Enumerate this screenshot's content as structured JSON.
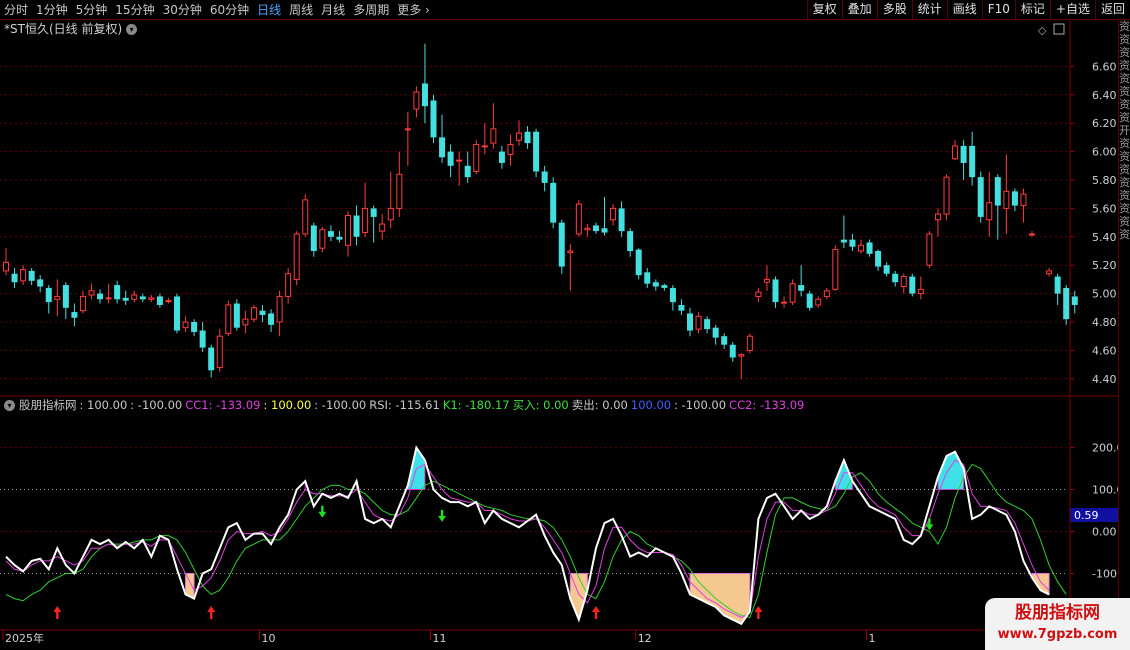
{
  "toolbar": {
    "periods": [
      "分时",
      "1分钟",
      "5分钟",
      "15分钟",
      "30分钟",
      "60分钟",
      "日线",
      "周线",
      "月线",
      "多周期",
      "更多"
    ],
    "active_index": 6,
    "buttons": [
      "复权",
      "叠加",
      "多股",
      "统计",
      "画线",
      "F10",
      "标记",
      "+自选",
      "返回"
    ]
  },
  "title": "*ST恒久(日线 前复权)",
  "indicator_bar": [
    {
      "text": "股朋指标网",
      "color": "#c8c8c8"
    },
    {
      "text": ": 100.00",
      "color": "#c8c8c8"
    },
    {
      "text": ": -100.00",
      "color": "#c8c8c8"
    },
    {
      "text": "CC1: -133.09",
      "color": "#e040e0"
    },
    {
      "text": ": 100.00",
      "color": "#ffff40"
    },
    {
      "text": ": -100.00",
      "color": "#c8c8c8"
    },
    {
      "text": "RSI: -115.61",
      "color": "#c8c8c8"
    },
    {
      "text": "K1: -180.17",
      "color": "#40e040"
    },
    {
      "text": "买入: 0.00",
      "color": "#40e040"
    },
    {
      "text": "卖出: 0.00",
      "color": "#c8c8c8"
    },
    {
      "text": "100.00",
      "color": "#4060ff"
    },
    {
      "text": ": -100.00",
      "color": "#c8c8c8"
    },
    {
      "text": "CC2: -133.09",
      "color": "#e040e0"
    }
  ],
  "right_strip": [
    "资",
    "资",
    "资",
    "资",
    "资",
    "资",
    "资",
    "资",
    "开",
    "资",
    "资",
    "资",
    "资",
    "资",
    "资",
    "资",
    "资"
  ],
  "watermark": {
    "title": "股朋指标网",
    "url": "www.7gpzb.com"
  },
  "chart_data": [
    {
      "type": "candlestick",
      "ylim": [
        4.3,
        6.8
      ],
      "y_ticks": [
        4.4,
        4.6,
        4.8,
        5.0,
        5.2,
        5.4,
        5.6,
        5.8,
        6.0,
        6.2,
        6.4,
        6.6
      ],
      "up_color": "#ff3c3c",
      "down_color": "#44e0e0",
      "candles": [
        [
          5.16,
          5.22,
          5.13,
          5.32
        ],
        [
          5.14,
          5.08,
          5.04,
          5.18
        ],
        [
          5.09,
          5.17,
          5.06,
          5.2
        ],
        [
          5.16,
          5.09,
          5.06,
          5.18
        ],
        [
          5.1,
          5.05,
          5.01,
          5.13
        ],
        [
          5.04,
          4.94,
          4.86,
          5.06
        ],
        [
          4.96,
          4.98,
          4.84,
          5.1
        ],
        [
          5.06,
          4.9,
          4.82,
          5.08
        ],
        [
          4.87,
          4.83,
          4.77,
          4.93
        ],
        [
          4.88,
          4.98,
          4.86,
          5.02
        ],
        [
          4.99,
          5.02,
          4.96,
          5.07
        ],
        [
          5.0,
          4.96,
          4.93,
          5.03
        ],
        [
          4.97,
          4.97,
          4.93,
          5.07
        ],
        [
          5.06,
          4.96,
          4.93,
          5.09
        ],
        [
          4.97,
          4.95,
          4.92,
          5.02
        ],
        [
          4.96,
          4.99,
          4.94,
          5.02
        ],
        [
          4.98,
          4.96,
          4.94,
          5.0
        ],
        [
          4.96,
          4.97,
          4.94,
          4.99
        ],
        [
          4.98,
          4.92,
          4.9,
          5.0
        ],
        [
          4.95,
          4.95,
          4.93,
          4.97
        ],
        [
          4.98,
          4.74,
          4.72,
          5.0
        ],
        [
          4.76,
          4.8,
          4.73,
          4.84
        ],
        [
          4.8,
          4.73,
          4.7,
          4.82
        ],
        [
          4.74,
          4.62,
          4.59,
          4.8
        ],
        [
          4.62,
          4.46,
          4.41,
          4.64
        ],
        [
          4.48,
          4.7,
          4.45,
          4.75
        ],
        [
          4.72,
          4.92,
          4.7,
          4.95
        ],
        [
          4.93,
          4.76,
          4.74,
          4.96
        ],
        [
          4.78,
          4.82,
          4.72,
          4.88
        ],
        [
          4.82,
          4.9,
          4.8,
          4.92
        ],
        [
          4.88,
          4.85,
          4.8,
          4.92
        ],
        [
          4.86,
          4.78,
          4.73,
          4.89
        ],
        [
          4.8,
          4.98,
          4.7,
          5.02
        ],
        [
          4.98,
          5.14,
          4.93,
          5.18
        ],
        [
          5.1,
          5.42,
          5.06,
          5.44
        ],
        [
          5.42,
          5.66,
          5.4,
          5.7
        ],
        [
          5.48,
          5.3,
          5.26,
          5.5
        ],
        [
          5.32,
          5.45,
          5.29,
          5.47
        ],
        [
          5.44,
          5.4,
          5.37,
          5.48
        ],
        [
          5.4,
          5.38,
          5.36,
          5.44
        ],
        [
          5.34,
          5.55,
          5.26,
          5.58
        ],
        [
          5.55,
          5.4,
          5.34,
          5.62
        ],
        [
          5.43,
          5.6,
          5.4,
          5.78
        ],
        [
          5.6,
          5.54,
          5.36,
          5.62
        ],
        [
          5.44,
          5.49,
          5.38,
          5.56
        ],
        [
          5.52,
          5.6,
          5.46,
          5.86
        ],
        [
          5.6,
          5.84,
          5.54,
          6.0
        ],
        [
          6.16,
          6.16,
          5.9,
          6.28
        ],
        [
          6.3,
          6.42,
          6.24,
          6.46
        ],
        [
          6.48,
          6.32,
          6.2,
          6.76
        ],
        [
          6.36,
          6.1,
          6.06,
          6.4
        ],
        [
          6.1,
          5.96,
          5.92,
          6.26
        ],
        [
          6.0,
          5.9,
          5.82,
          6.05
        ],
        [
          5.94,
          5.94,
          5.76,
          6.0
        ],
        [
          5.9,
          5.82,
          5.78,
          6.0
        ],
        [
          5.86,
          6.05,
          5.84,
          6.08
        ],
        [
          6.04,
          6.04,
          5.98,
          6.2
        ],
        [
          6.06,
          6.16,
          6.02,
          6.34
        ],
        [
          6.0,
          5.92,
          5.88,
          6.04
        ],
        [
          5.98,
          6.05,
          5.9,
          6.12
        ],
        [
          6.08,
          6.13,
          6.04,
          6.22
        ],
        [
          6.14,
          6.06,
          6.02,
          6.18
        ],
        [
          6.14,
          5.86,
          5.82,
          6.16
        ],
        [
          5.86,
          5.78,
          5.72,
          5.9
        ],
        [
          5.78,
          5.5,
          5.46,
          5.82
        ],
        [
          5.5,
          5.19,
          5.14,
          5.52
        ],
        [
          5.29,
          5.3,
          5.02,
          5.35
        ],
        [
          5.42,
          5.63,
          5.4,
          5.66
        ],
        [
          5.45,
          5.46,
          5.4,
          5.49
        ],
        [
          5.48,
          5.44,
          5.42,
          5.5
        ],
        [
          5.46,
          5.43,
          5.41,
          5.68
        ],
        [
          5.52,
          5.6,
          5.48,
          5.63
        ],
        [
          5.6,
          5.44,
          5.4,
          5.65
        ],
        [
          5.44,
          5.3,
          5.26,
          5.46
        ],
        [
          5.31,
          5.13,
          5.1,
          5.32
        ],
        [
          5.15,
          5.07,
          5.04,
          5.18
        ],
        [
          5.08,
          5.05,
          5.02,
          5.1
        ],
        [
          5.06,
          5.04,
          5.02,
          5.07
        ],
        [
          5.04,
          4.94,
          4.88,
          5.06
        ],
        [
          4.92,
          4.88,
          4.85,
          4.96
        ],
        [
          4.86,
          4.74,
          4.7,
          4.9
        ],
        [
          4.75,
          4.84,
          4.72,
          4.87
        ],
        [
          4.82,
          4.75,
          4.72,
          4.84
        ],
        [
          4.76,
          4.69,
          4.64,
          4.78
        ],
        [
          4.7,
          4.64,
          4.61,
          4.72
        ],
        [
          4.64,
          4.55,
          4.52,
          4.66
        ],
        [
          4.56,
          4.57,
          4.4,
          4.58
        ],
        [
          4.6,
          4.7,
          4.58,
          4.72
        ],
        [
          4.98,
          5.01,
          4.94,
          5.04
        ],
        [
          5.08,
          5.1,
          5.02,
          5.2
        ],
        [
          5.1,
          4.94,
          4.9,
          5.12
        ],
        [
          4.94,
          4.94,
          4.9,
          4.98
        ],
        [
          4.94,
          5.07,
          4.92,
          5.1
        ],
        [
          5.06,
          5.02,
          4.98,
          5.2
        ],
        [
          5.0,
          4.9,
          4.88,
          5.02
        ],
        [
          4.92,
          4.96,
          4.9,
          4.98
        ],
        [
          4.98,
          5.02,
          4.96,
          5.04
        ],
        [
          5.03,
          5.31,
          5.02,
          5.34
        ],
        [
          5.38,
          5.36,
          5.32,
          5.55
        ],
        [
          5.38,
          5.33,
          5.3,
          5.42
        ],
        [
          5.3,
          5.34,
          5.28,
          5.38
        ],
        [
          5.36,
          5.28,
          5.26,
          5.38
        ],
        [
          5.3,
          5.19,
          5.16,
          5.31
        ],
        [
          5.2,
          5.14,
          5.12,
          5.22
        ],
        [
          5.14,
          5.08,
          5.05,
          5.16
        ],
        [
          5.05,
          5.12,
          5.0,
          5.14
        ],
        [
          5.12,
          5.0,
          4.98,
          5.14
        ],
        [
          5.0,
          5.03,
          4.96,
          5.12
        ],
        [
          5.2,
          5.42,
          5.18,
          5.44
        ],
        [
          5.52,
          5.56,
          5.4,
          5.6
        ],
        [
          5.56,
          5.82,
          5.52,
          5.84
        ],
        [
          5.95,
          6.04,
          5.94,
          6.08
        ],
        [
          6.04,
          5.92,
          5.8,
          6.08
        ],
        [
          6.04,
          5.82,
          5.76,
          6.14
        ],
        [
          5.82,
          5.54,
          5.5,
          5.86
        ],
        [
          5.52,
          5.64,
          5.4,
          5.86
        ],
        [
          5.82,
          5.62,
          5.38,
          5.84
        ],
        [
          5.6,
          5.72,
          5.42,
          5.98
        ],
        [
          5.72,
          5.62,
          5.58,
          5.74
        ],
        [
          5.62,
          5.7,
          5.5,
          5.74
        ],
        [
          5.42,
          5.42,
          5.4,
          5.44
        ],
        null,
        [
          5.14,
          5.16,
          5.12,
          5.18
        ],
        [
          5.12,
          5.0,
          4.92,
          5.14
        ],
        [
          5.04,
          4.82,
          4.78,
          5.06
        ],
        [
          4.98,
          4.92,
          4.86,
          5.02
        ]
      ]
    },
    {
      "type": "line",
      "ylim": [
        -230,
        280
      ],
      "y_ticks": [
        -100.0,
        0.0,
        100.0,
        200.0
      ],
      "y_tick_labels": [
        "-100.0",
        "0.00",
        "100.0",
        "200.0"
      ],
      "badge_value": "0.59",
      "upper_level": 100,
      "lower_level": -100,
      "series": [
        {
          "color": "#ffffff",
          "values": [
            -60,
            -80,
            -95,
            -70,
            -65,
            -90,
            -40,
            -80,
            -100,
            -60,
            -20,
            -30,
            -20,
            -40,
            -25,
            -40,
            -20,
            -60,
            -10,
            -20,
            -90,
            -150,
            -160,
            -100,
            -90,
            -40,
            10,
            20,
            -20,
            -5,
            -5,
            -30,
            10,
            40,
            100,
            120,
            60,
            90,
            80,
            90,
            80,
            120,
            30,
            20,
            30,
            10,
            60,
            110,
            200,
            170,
            100,
            80,
            70,
            70,
            60,
            70,
            20,
            50,
            30,
            20,
            10,
            25,
            40,
            -10,
            -50,
            -80,
            -160,
            -210,
            -140,
            -40,
            20,
            30,
            -10,
            -60,
            -50,
            -60,
            -40,
            -50,
            -60,
            -100,
            -150,
            -160,
            -170,
            -180,
            -200,
            -210,
            -220,
            -190,
            30,
            80,
            90,
            60,
            30,
            50,
            30,
            40,
            60,
            120,
            170,
            120,
            90,
            60,
            50,
            40,
            30,
            -20,
            -30,
            -10,
            60,
            130,
            180,
            190,
            150,
            30,
            40,
            60,
            50,
            40,
            0,
            -70,
            -110,
            -140,
            -150
          ],
          "name": ""
        },
        {
          "color": "#e040e0",
          "values": [
            -70,
            -90,
            -95,
            -80,
            -70,
            -70,
            -60,
            -70,
            -80,
            -70,
            -40,
            -40,
            -30,
            -35,
            -30,
            -30,
            -25,
            -35,
            -20,
            -20,
            -60,
            -100,
            -140,
            -130,
            -110,
            -70,
            -20,
            0,
            -5,
            -5,
            0,
            -10,
            0,
            30,
            70,
            100,
            90,
            90,
            85,
            85,
            85,
            100,
            70,
            40,
            30,
            25,
            40,
            80,
            150,
            160,
            130,
            100,
            80,
            75,
            70,
            70,
            50,
            50,
            40,
            30,
            25,
            25,
            30,
            10,
            -20,
            -50,
            -100,
            -150,
            -170,
            -130,
            -40,
            10,
            10,
            -20,
            -40,
            -50,
            -50,
            -50,
            -55,
            -80,
            -120,
            -140,
            -160,
            -170,
            -185,
            -195,
            -205,
            -195,
            -60,
            30,
            70,
            70,
            50,
            50,
            40,
            40,
            50,
            90,
            140,
            140,
            110,
            80,
            60,
            50,
            40,
            10,
            -10,
            -10,
            30,
            90,
            140,
            170,
            160,
            90,
            60,
            60,
            55,
            50,
            20,
            -30,
            -80,
            -120,
            -140
          ],
          "name": ""
        },
        {
          "color": "#30d030",
          "values": [
            -150,
            -160,
            -165,
            -150,
            -140,
            -120,
            -110,
            -100,
            -100,
            -90,
            -60,
            -40,
            -30,
            -30,
            -30,
            -25,
            -20,
            -20,
            -10,
            -10,
            -20,
            -50,
            -90,
            -130,
            -150,
            -140,
            -110,
            -70,
            -40,
            -30,
            -20,
            -20,
            -20,
            0,
            30,
            60,
            80,
            100,
            110,
            110,
            100,
            100,
            90,
            70,
            50,
            40,
            40,
            50,
            80,
            110,
            120,
            110,
            100,
            90,
            80,
            70,
            60,
            55,
            50,
            40,
            35,
            30,
            30,
            25,
            10,
            -20,
            -60,
            -110,
            -150,
            -160,
            -120,
            -60,
            -20,
            0,
            -10,
            -30,
            -40,
            -50,
            -60,
            -70,
            -90,
            -120,
            -140,
            -160,
            -175,
            -190,
            -200,
            -205,
            -150,
            -50,
            40,
            80,
            80,
            70,
            60,
            55,
            50,
            60,
            90,
            130,
            140,
            120,
            90,
            70,
            55,
            40,
            20,
            10,
            0,
            -30,
            10,
            80,
            130,
            160,
            150,
            120,
            90,
            70,
            60,
            50,
            30,
            -20,
            -80,
            -120,
            -150
          ],
          "name": ""
        }
      ],
      "buy_arrows": [
        6,
        24,
        69,
        88
      ],
      "sell_arrows": [
        37,
        51,
        108,
        121
      ]
    }
  ],
  "x_axis": {
    "labels": [
      {
        "text": "2025年",
        "index": 0
      },
      {
        "text": "10",
        "index": 30
      },
      {
        "text": "11",
        "index": 50
      },
      {
        "text": "12",
        "index": 74
      },
      {
        "text": "1",
        "index": 101
      }
    ]
  }
}
